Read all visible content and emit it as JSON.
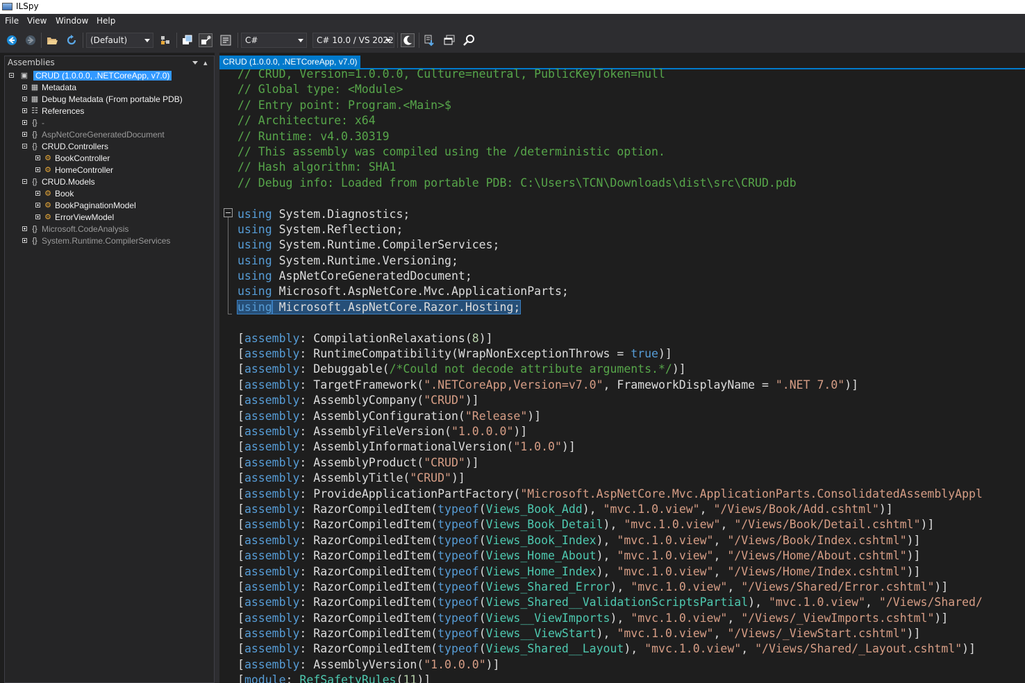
{
  "window": {
    "title": "ILSpy"
  },
  "menu": [
    "File",
    "View",
    "Window",
    "Help"
  ],
  "toolbar": {
    "buttons": [
      "back-icon",
      "forward-icon",
      "open-icon",
      "reload-icon",
      "manage-lists-icon",
      "show-api-icon",
      "show-all-icon",
      "theme-icon",
      "decompile-icon",
      "window-icon",
      "search-icon"
    ],
    "assembly_list": "(Default)",
    "language": "C#",
    "language_version": "C# 10.0 / VS 2022"
  },
  "assemblies_panel": {
    "title": "Assemblies",
    "tree": [
      {
        "label": "CRUD (1.0.0.0, .NETCoreApp, v7.0)",
        "icon": "assembly-icon",
        "selected": true
      },
      {
        "label": "Metadata",
        "icon": "table-icon"
      },
      {
        "label": "Debug Metadata (From portable PDB)",
        "icon": "table-icon"
      },
      {
        "label": "References",
        "icon": "references-icon"
      },
      {
        "label": "-",
        "icon": "namespace-icon",
        "dim": true
      },
      {
        "label": "AspNetCoreGeneratedDocument",
        "icon": "namespace-icon",
        "dim": true
      },
      {
        "label": "CRUD.Controllers",
        "icon": "namespace-icon"
      },
      {
        "label": "BookController",
        "icon": "class-icon"
      },
      {
        "label": "HomeController",
        "icon": "class-icon"
      },
      {
        "label": "CRUD.Models",
        "icon": "namespace-icon"
      },
      {
        "label": "Book",
        "icon": "class-icon"
      },
      {
        "label": "BookPaginationModel",
        "icon": "class-icon"
      },
      {
        "label": "ErrorViewModel",
        "icon": "class-icon"
      },
      {
        "label": "Microsoft.CodeAnalysis",
        "icon": "namespace-icon",
        "dim": true
      },
      {
        "label": "System.Runtime.CompilerServices",
        "icon": "namespace-icon",
        "dim": true
      }
    ]
  },
  "document": {
    "tab_title": "CRUD (1.0.0.0, .NETCoreApp, v7.0)",
    "code": [
      [
        [
          "c",
          "// CRUD, Version=1.0.0.0, Culture=neutral, PublicKeyToken=null"
        ]
      ],
      [
        [
          "c",
          "// Global type: <Module>"
        ]
      ],
      [
        [
          "c",
          "// Entry point: Program.<Main>$"
        ]
      ],
      [
        [
          "c",
          "// Architecture: x64"
        ]
      ],
      [
        [
          "c",
          "// Runtime: v4.0.30319"
        ]
      ],
      [
        [
          "c",
          "// This assembly was compiled using the /deterministic option."
        ]
      ],
      [
        [
          "c",
          "// Hash algorithm: SHA1"
        ]
      ],
      [
        [
          "c",
          "// Debug info: Loaded from portable PDB: C:\\Users\\TCN\\Downloads\\dist\\src\\CRUD.pdb"
        ]
      ],
      [],
      [
        [
          "k",
          "using"
        ],
        [
          "p",
          " System.Diagnostics;"
        ]
      ],
      [
        [
          "k",
          "using"
        ],
        [
          "p",
          " System.Reflection;"
        ]
      ],
      [
        [
          "k",
          "using"
        ],
        [
          "p",
          " System.Runtime.CompilerServices;"
        ]
      ],
      [
        [
          "k",
          "using"
        ],
        [
          "p",
          " System.Runtime.Versioning;"
        ]
      ],
      [
        [
          "k",
          "using"
        ],
        [
          "p",
          " AspNetCoreGeneratedDocument;"
        ]
      ],
      [
        [
          "k",
          "using"
        ],
        [
          "p",
          " Microsoft.AspNetCore.Mvc.ApplicationParts;"
        ]
      ],
      [
        [
          "ks",
          "using"
        ],
        [
          "ps",
          " Microsoft.AspNetCore.Razor.Hosting;"
        ]
      ],
      [],
      [
        [
          "p",
          "["
        ],
        [
          "k",
          "assembly"
        ],
        [
          "p",
          ": CompilationRelaxations("
        ],
        [
          "n",
          "8"
        ],
        [
          "p",
          ")]"
        ]
      ],
      [
        [
          "p",
          "["
        ],
        [
          "k",
          "assembly"
        ],
        [
          "p",
          ": RuntimeCompatibility(WrapNonExceptionThrows = "
        ],
        [
          "k",
          "true"
        ],
        [
          "p",
          ")]"
        ]
      ],
      [
        [
          "p",
          "["
        ],
        [
          "k",
          "assembly"
        ],
        [
          "p",
          ": Debuggable("
        ],
        [
          "c",
          "/*Could not decode attribute arguments.*/"
        ],
        [
          "p",
          ")]"
        ]
      ],
      [
        [
          "p",
          "["
        ],
        [
          "k",
          "assembly"
        ],
        [
          "p",
          ": TargetFramework("
        ],
        [
          "s",
          "\".NETCoreApp,Version=v7.0\""
        ],
        [
          "p",
          ", FrameworkDisplayName = "
        ],
        [
          "s",
          "\".NET 7.0\""
        ],
        [
          "p",
          ")]"
        ]
      ],
      [
        [
          "p",
          "["
        ],
        [
          "k",
          "assembly"
        ],
        [
          "p",
          ": AssemblyCompany("
        ],
        [
          "s",
          "\"CRUD\""
        ],
        [
          "p",
          ")]"
        ]
      ],
      [
        [
          "p",
          "["
        ],
        [
          "k",
          "assembly"
        ],
        [
          "p",
          ": AssemblyConfiguration("
        ],
        [
          "s",
          "\"Release\""
        ],
        [
          "p",
          ")]"
        ]
      ],
      [
        [
          "p",
          "["
        ],
        [
          "k",
          "assembly"
        ],
        [
          "p",
          ": AssemblyFileVersion("
        ],
        [
          "s",
          "\"1.0.0.0\""
        ],
        [
          "p",
          ")]"
        ]
      ],
      [
        [
          "p",
          "["
        ],
        [
          "k",
          "assembly"
        ],
        [
          "p",
          ": AssemblyInformationalVersion("
        ],
        [
          "s",
          "\"1.0.0\""
        ],
        [
          "p",
          ")]"
        ]
      ],
      [
        [
          "p",
          "["
        ],
        [
          "k",
          "assembly"
        ],
        [
          "p",
          ": AssemblyProduct("
        ],
        [
          "s",
          "\"CRUD\""
        ],
        [
          "p",
          ")]"
        ]
      ],
      [
        [
          "p",
          "["
        ],
        [
          "k",
          "assembly"
        ],
        [
          "p",
          ": AssemblyTitle("
        ],
        [
          "s",
          "\"CRUD\""
        ],
        [
          "p",
          ")]"
        ]
      ],
      [
        [
          "p",
          "["
        ],
        [
          "k",
          "assembly"
        ],
        [
          "p",
          ": ProvideApplicationPartFactory("
        ],
        [
          "s",
          "\"Microsoft.AspNetCore.Mvc.ApplicationParts.ConsolidatedAssemblyAppl"
        ]
      ],
      [
        [
          "p",
          "["
        ],
        [
          "k",
          "assembly"
        ],
        [
          "p",
          ": RazorCompiledItem("
        ],
        [
          "k",
          "typeof"
        ],
        [
          "p",
          "("
        ],
        [
          "t",
          "Views_Book_Add"
        ],
        [
          "p",
          "), "
        ],
        [
          "s",
          "\"mvc.1.0.view\""
        ],
        [
          "p",
          ", "
        ],
        [
          "s",
          "\"/Views/Book/Add.cshtml\""
        ],
        [
          "p",
          ")]"
        ]
      ],
      [
        [
          "p",
          "["
        ],
        [
          "k",
          "assembly"
        ],
        [
          "p",
          ": RazorCompiledItem("
        ],
        [
          "k",
          "typeof"
        ],
        [
          "p",
          "("
        ],
        [
          "t",
          "Views_Book_Detail"
        ],
        [
          "p",
          "), "
        ],
        [
          "s",
          "\"mvc.1.0.view\""
        ],
        [
          "p",
          ", "
        ],
        [
          "s",
          "\"/Views/Book/Detail.cshtml\""
        ],
        [
          "p",
          ")]"
        ]
      ],
      [
        [
          "p",
          "["
        ],
        [
          "k",
          "assembly"
        ],
        [
          "p",
          ": RazorCompiledItem("
        ],
        [
          "k",
          "typeof"
        ],
        [
          "p",
          "("
        ],
        [
          "t",
          "Views_Book_Index"
        ],
        [
          "p",
          "), "
        ],
        [
          "s",
          "\"mvc.1.0.view\""
        ],
        [
          "p",
          ", "
        ],
        [
          "s",
          "\"/Views/Book/Index.cshtml\""
        ],
        [
          "p",
          ")]"
        ]
      ],
      [
        [
          "p",
          "["
        ],
        [
          "k",
          "assembly"
        ],
        [
          "p",
          ": RazorCompiledItem("
        ],
        [
          "k",
          "typeof"
        ],
        [
          "p",
          "("
        ],
        [
          "t",
          "Views_Home_About"
        ],
        [
          "p",
          "), "
        ],
        [
          "s",
          "\"mvc.1.0.view\""
        ],
        [
          "p",
          ", "
        ],
        [
          "s",
          "\"/Views/Home/About.cshtml\""
        ],
        [
          "p",
          ")]"
        ]
      ],
      [
        [
          "p",
          "["
        ],
        [
          "k",
          "assembly"
        ],
        [
          "p",
          ": RazorCompiledItem("
        ],
        [
          "k",
          "typeof"
        ],
        [
          "p",
          "("
        ],
        [
          "t",
          "Views_Home_Index"
        ],
        [
          "p",
          "), "
        ],
        [
          "s",
          "\"mvc.1.0.view\""
        ],
        [
          "p",
          ", "
        ],
        [
          "s",
          "\"/Views/Home/Index.cshtml\""
        ],
        [
          "p",
          ")]"
        ]
      ],
      [
        [
          "p",
          "["
        ],
        [
          "k",
          "assembly"
        ],
        [
          "p",
          ": RazorCompiledItem("
        ],
        [
          "k",
          "typeof"
        ],
        [
          "p",
          "("
        ],
        [
          "t",
          "Views_Shared_Error"
        ],
        [
          "p",
          "), "
        ],
        [
          "s",
          "\"mvc.1.0.view\""
        ],
        [
          "p",
          ", "
        ],
        [
          "s",
          "\"/Views/Shared/Error.cshtml\""
        ],
        [
          "p",
          ")]"
        ]
      ],
      [
        [
          "p",
          "["
        ],
        [
          "k",
          "assembly"
        ],
        [
          "p",
          ": RazorCompiledItem("
        ],
        [
          "k",
          "typeof"
        ],
        [
          "p",
          "("
        ],
        [
          "t",
          "Views_Shared__ValidationScriptsPartial"
        ],
        [
          "p",
          "), "
        ],
        [
          "s",
          "\"mvc.1.0.view\""
        ],
        [
          "p",
          ", "
        ],
        [
          "s",
          "\"/Views/Shared/"
        ]
      ],
      [
        [
          "p",
          "["
        ],
        [
          "k",
          "assembly"
        ],
        [
          "p",
          ": RazorCompiledItem("
        ],
        [
          "k",
          "typeof"
        ],
        [
          "p",
          "("
        ],
        [
          "t",
          "Views__ViewImports"
        ],
        [
          "p",
          "), "
        ],
        [
          "s",
          "\"mvc.1.0.view\""
        ],
        [
          "p",
          ", "
        ],
        [
          "s",
          "\"/Views/_ViewImports.cshtml\""
        ],
        [
          "p",
          ")]"
        ]
      ],
      [
        [
          "p",
          "["
        ],
        [
          "k",
          "assembly"
        ],
        [
          "p",
          ": RazorCompiledItem("
        ],
        [
          "k",
          "typeof"
        ],
        [
          "p",
          "("
        ],
        [
          "t",
          "Views__ViewStart"
        ],
        [
          "p",
          "), "
        ],
        [
          "s",
          "\"mvc.1.0.view\""
        ],
        [
          "p",
          ", "
        ],
        [
          "s",
          "\"/Views/_ViewStart.cshtml\""
        ],
        [
          "p",
          ")]"
        ]
      ],
      [
        [
          "p",
          "["
        ],
        [
          "k",
          "assembly"
        ],
        [
          "p",
          ": RazorCompiledItem("
        ],
        [
          "k",
          "typeof"
        ],
        [
          "p",
          "("
        ],
        [
          "t",
          "Views_Shared__Layout"
        ],
        [
          "p",
          "), "
        ],
        [
          "s",
          "\"mvc.1.0.view\""
        ],
        [
          "p",
          ", "
        ],
        [
          "s",
          "\"/Views/Shared/_Layout.cshtml\""
        ],
        [
          "p",
          ")]"
        ]
      ],
      [
        [
          "p",
          "["
        ],
        [
          "k",
          "assembly"
        ],
        [
          "p",
          ": AssemblyVersion("
        ],
        [
          "s",
          "\"1.0.0.0\""
        ],
        [
          "p",
          ")]"
        ]
      ],
      [
        [
          "p",
          "["
        ],
        [
          "k",
          "module"
        ],
        [
          "p",
          ": "
        ],
        [
          "t",
          "RefSafetyRules"
        ],
        [
          "p",
          "("
        ],
        [
          "n",
          "11"
        ],
        [
          "p",
          ")]"
        ]
      ]
    ]
  },
  "colors": {
    "comment": "#57a64a",
    "keyword": "#569cd6",
    "type": "#4ec9b0",
    "string": "#d69d85",
    "number": "#b5cea8",
    "selection": "#264f78",
    "accent": "#007acc"
  }
}
